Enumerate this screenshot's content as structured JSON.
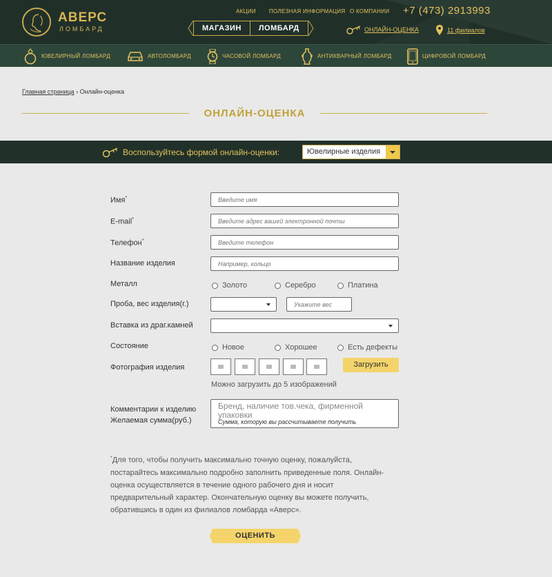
{
  "header": {
    "brand_name": "АВЕРС",
    "brand_sub": "ЛОМБАРД",
    "top_links": [
      "АКЦИИ",
      "ПОЛЕЗНАЯ ИНФОРМАЦИЯ",
      "О КОМПАНИИ"
    ],
    "phone": "+7 (473) 2913993",
    "shop_label_1": "МАГАЗИН",
    "shop_label_2": "ЛОМБАРД",
    "online_link": "ОНЛАЙН-ОЦЕНКА",
    "branches_link": "11 филиалов"
  },
  "categories": [
    {
      "label": "ЮВЕЛИРНЫЙ ЛОМБАРД",
      "icon": "ring-icon"
    },
    {
      "label": "АВТОЛОМБАРД",
      "icon": "car-icon"
    },
    {
      "label": "ЧАСОВОЙ ЛОМБАРД",
      "icon": "watch-icon"
    },
    {
      "label": "АНТИКВАРНЫЙ ЛОМБАРД",
      "icon": "vase-icon"
    },
    {
      "label": "ЦИФРОВОЙ ЛОМБАРД",
      "icon": "phone-icon"
    }
  ],
  "breadcrumb": {
    "home": "Главная страница",
    "separator": "›",
    "current": "Онлайн-оценка"
  },
  "page_title": "ОНЛАЙН-ОЦЕНКА",
  "form_selector": {
    "label": "Воспользуйтесь формой онлайн-оценки:",
    "selected": "Ювелирные изделия"
  },
  "form": {
    "name_label": "Имя",
    "name_placeholder": "Введите имя",
    "email_label": "E-mail",
    "email_placeholder": "Введите адрес вашей электронной почты",
    "phone_label": "Телефон",
    "phone_placeholder": "Введите телефон",
    "item_label": "Название изделия",
    "item_placeholder": "Например, кольцо",
    "metal_label": "Металл",
    "metal_options": [
      "Золото",
      "Серебро",
      "Платина"
    ],
    "probe_label": "Проба, вес изделия(г.)",
    "weight_placeholder": "Укажите вес",
    "stones_label": "Вставка из драг.камней",
    "condition_label": "Состояние",
    "condition_options": [
      "Новое",
      "Хорошее",
      "Есть дефекты"
    ],
    "photo_label": "Фотография изделия",
    "upload_label": "Загрузить",
    "upload_hint": "Можно загрузить до 5 изображений",
    "comment_label": "Комментарии к изделию",
    "sum_label": "Желаемая сумма(руб.)",
    "comment_placeholder": "Бренд, наличие тов.чека, фирменной упаковки",
    "sum_placeholder": "Сумма, которую вы рассчитываете получить",
    "required_mark": "*",
    "note": "Для того, чтобы получить максимально точную оценку, пожалуйста, постарайтесь максимально подробно заполнить приведенные поля. Онлайн-оценка осуществляется в течение одного рабочего дня и носит предварительный характер. Окончательную оценку вы можете получить, обратившись в один из филиалов ломбарда «Аверс».",
    "submit_label": "ОЦЕНИТЬ"
  },
  "colors": {
    "header_bg": "#203029",
    "catbar_bg": "#2d463a",
    "gold": "#e3c25f",
    "button_yellow": "#f4d46a"
  }
}
